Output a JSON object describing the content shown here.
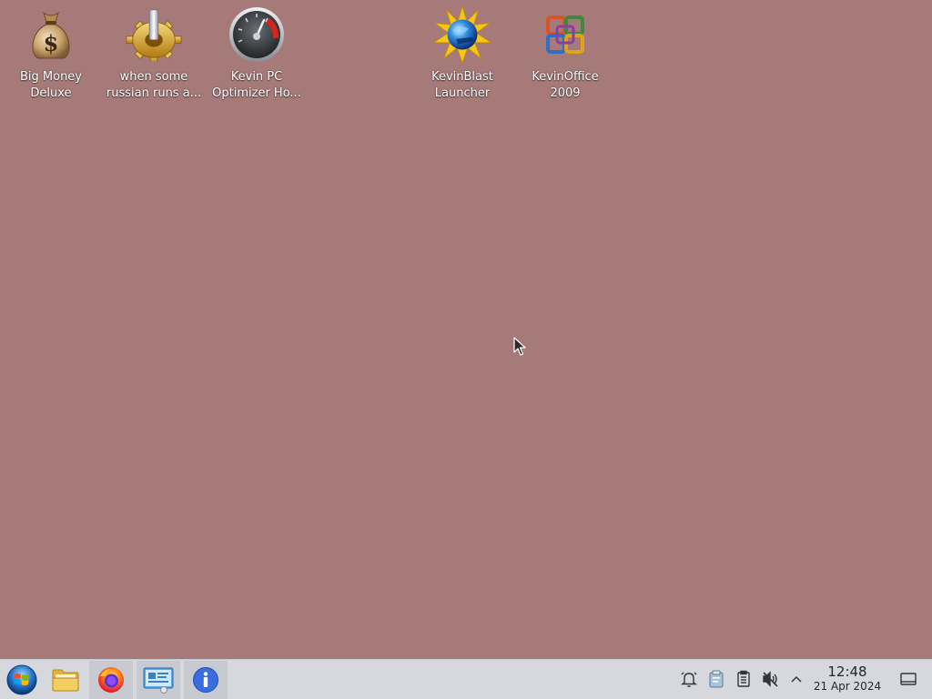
{
  "desktop": {
    "background_color": "#a67a79",
    "icons": [
      {
        "line1": "Big Money",
        "line2": "Deluxe",
        "icon": "money-bag-icon"
      },
      {
        "line1": "when some",
        "line2": "russian runs a...",
        "icon": "gear-icon"
      },
      {
        "line1": "Kevin PC",
        "line2": "Optimizer Ho...",
        "icon": "speedometer-icon"
      },
      {
        "line1": "KevinBlast",
        "line2": "Launcher",
        "icon": "globe-burst-icon"
      },
      {
        "line1": "KevinOffice",
        "line2": "2009",
        "icon": "office-logo-icon"
      }
    ]
  },
  "taskbar": {
    "background_color": "#d6d8de",
    "launchers": [
      {
        "name": "start-menu",
        "icon": "start-orb-icon"
      },
      {
        "name": "file-manager",
        "icon": "folder-icon"
      },
      {
        "name": "firefox",
        "icon": "firefox-icon",
        "active": true
      },
      {
        "name": "system-monitor",
        "icon": "monitor-icon",
        "active": true
      },
      {
        "name": "info-center",
        "icon": "info-icon",
        "active": true
      }
    ],
    "tray": {
      "icons": [
        "alarm-bell-icon",
        "clipboard-icon",
        "notes-icon",
        "volume-muted-icon",
        "chevron-up-icon"
      ]
    },
    "clock": {
      "time": "12:48",
      "date": "21 Apr 2024"
    },
    "show_desktop_icon": "show-desktop-icon"
  }
}
